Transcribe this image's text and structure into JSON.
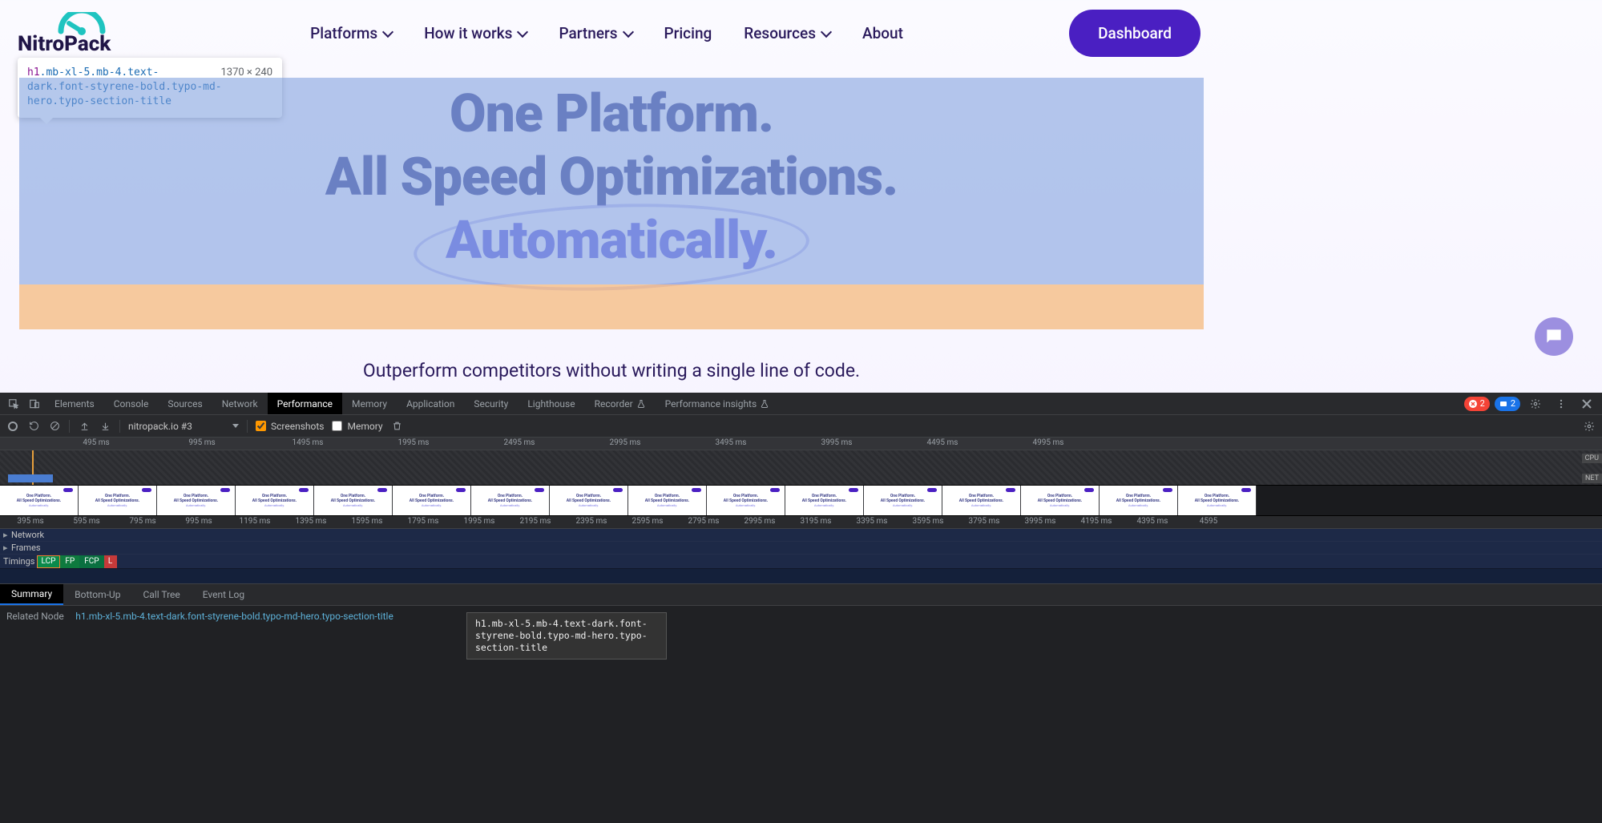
{
  "header": {
    "brand_first": "Nitro",
    "brand_second": "Pack",
    "nav": [
      {
        "label": "Platforms",
        "dropdown": true
      },
      {
        "label": "How it works",
        "dropdown": true
      },
      {
        "label": "Partners",
        "dropdown": true
      },
      {
        "label": "Pricing",
        "dropdown": false
      },
      {
        "label": "Resources",
        "dropdown": true
      },
      {
        "label": "About",
        "dropdown": false
      }
    ],
    "cta": "Dashboard"
  },
  "inspect_tooltip": {
    "tag": "h1",
    "classes": ".mb-xl-5.mb-4.text-dark.font-styrene-bold.typo-md-hero.typo-section-title",
    "dims": "1370 × 240"
  },
  "hero": {
    "line1": "One Platform.",
    "line2": "All Speed Optimizations.",
    "line3": "Automatically.",
    "sub": "Outperform competitors without writing a single line of code."
  },
  "devtools": {
    "panels": [
      "Elements",
      "Console",
      "Sources",
      "Network",
      "Performance",
      "Memory",
      "Application",
      "Security",
      "Lighthouse",
      "Recorder",
      "Performance insights"
    ],
    "active_panel": "Performance",
    "errors_count": "2",
    "messages_count": "2",
    "recording_name": "nitropack.io #3",
    "screenshots_checked": true,
    "memory_checked": false,
    "toolbar_labels": {
      "screenshots": "Screenshots",
      "memory": "Memory"
    },
    "ruler_top": [
      "495 ms",
      "995 ms",
      "1495 ms",
      "1995 ms",
      "2495 ms",
      "2995 ms",
      "3495 ms",
      "3995 ms",
      "4495 ms",
      "4995 ms"
    ],
    "overview_labels": {
      "cpu": "CPU",
      "net": "NET"
    },
    "filmstrip_texts": {
      "l1": "One Platform.",
      "l2": "All Speed Optimizations.",
      "l3": "Automatically."
    },
    "ruler_main": [
      "395 ms",
      "595 ms",
      "795 ms",
      "995 ms",
      "1195 ms",
      "1395 ms",
      "1595 ms",
      "1795 ms",
      "1995 ms",
      "2195 ms",
      "2395 ms",
      "2595 ms",
      "2795 ms",
      "2995 ms",
      "3195 ms",
      "3395 ms",
      "3595 ms",
      "3795 ms",
      "3995 ms",
      "4195 ms",
      "4395 ms",
      "4595"
    ],
    "tracks": [
      "Network",
      "Frames"
    ],
    "timings": {
      "label": "Timings",
      "lcp": "LCP",
      "fp": "FP",
      "fcp": "FCP",
      "l": "L"
    },
    "hover_tooltip": "h1.mb-xl-5.mb-4.text-dark.font-styrene-bold.typo-md-hero.typo-section-title",
    "details_tabs": [
      "Summary",
      "Bottom-Up",
      "Call Tree",
      "Event Log"
    ],
    "details_active": "Summary",
    "related_label": "Related Node",
    "related_node": "h1.mb-xl-5.mb-4.text-dark.font-styrene-bold.typo-md-hero.typo-section-title"
  }
}
